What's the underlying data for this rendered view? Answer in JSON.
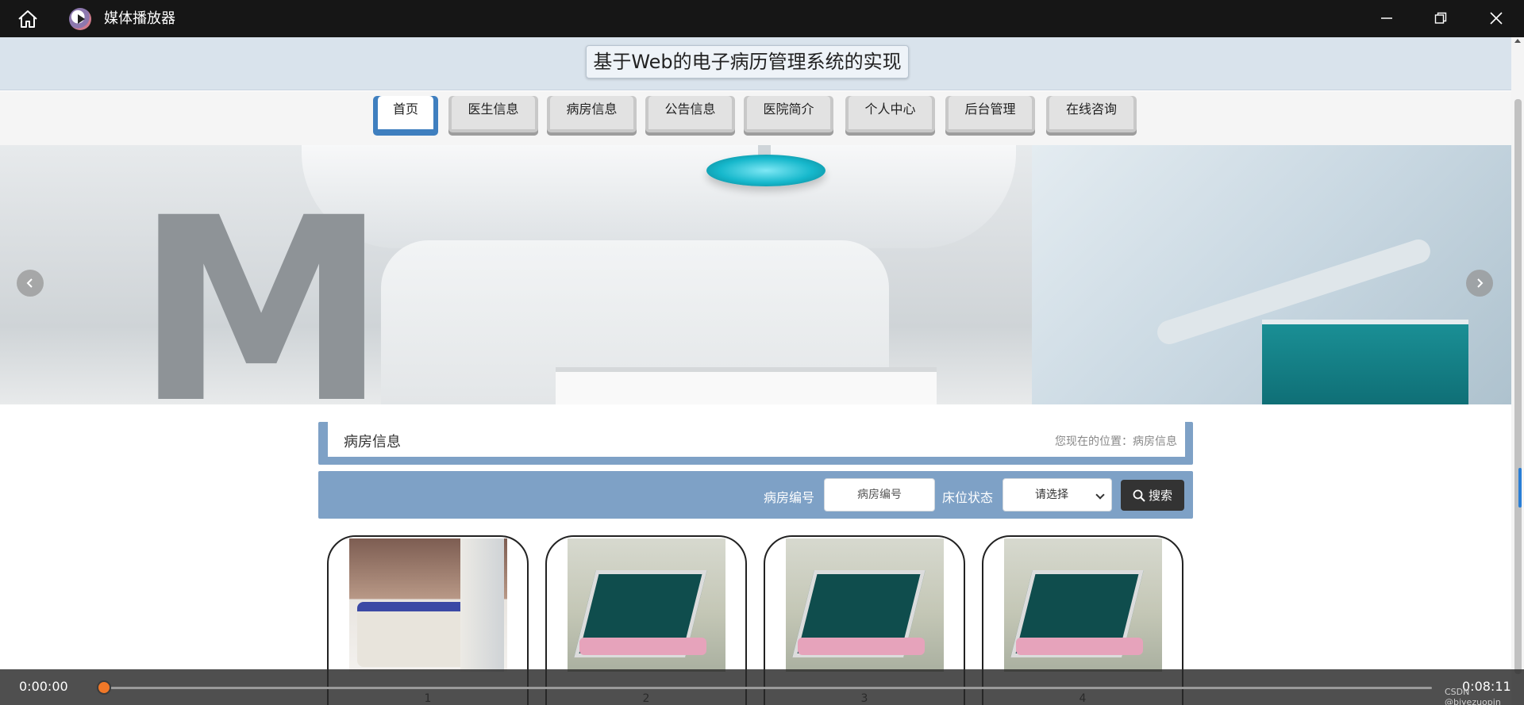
{
  "window": {
    "app_title": "媒体播放器",
    "icons": {
      "home": "home-icon",
      "app": "play-icon",
      "minimize": "minimize-icon",
      "maximize": "restore-icon",
      "close": "close-icon"
    }
  },
  "site": {
    "title": "基于Web的电子病历管理系统的实现"
  },
  "nav": {
    "items": [
      {
        "label": "首页",
        "active": true
      },
      {
        "label": "医生信息",
        "active": false
      },
      {
        "label": "病房信息",
        "active": false
      },
      {
        "label": "公告信息",
        "active": false
      },
      {
        "label": "医院简介",
        "active": false
      },
      {
        "label": "个人中心",
        "active": false
      },
      {
        "label": "后台管理",
        "active": false
      },
      {
        "label": "在线咨询",
        "active": false
      }
    ]
  },
  "banner": {
    "slides": 3,
    "active_slide": 2,
    "icons": {
      "prev": "chevron-left-icon",
      "next": "chevron-right-icon"
    }
  },
  "section": {
    "title": "病房信息",
    "location": "您现在的位置：病房信息"
  },
  "search": {
    "room_no_label": "病房编号",
    "room_no_placeholder": "病房编号",
    "bed_status_label": "床位状态",
    "bed_status_selected": "请选择",
    "search_button": "搜索"
  },
  "cards": [
    {
      "number": "1"
    },
    {
      "number": "2"
    },
    {
      "number": "3"
    },
    {
      "number": "4"
    }
  ],
  "player": {
    "current_time": "0:00:00",
    "total_time": "0:08:11",
    "progress": 0,
    "watermark": "CSDN @biyezuopin",
    "accent_color": "#f07828"
  },
  "colors": {
    "accent": "#7ea1c6",
    "active_tab": "#3f7fbf"
  }
}
